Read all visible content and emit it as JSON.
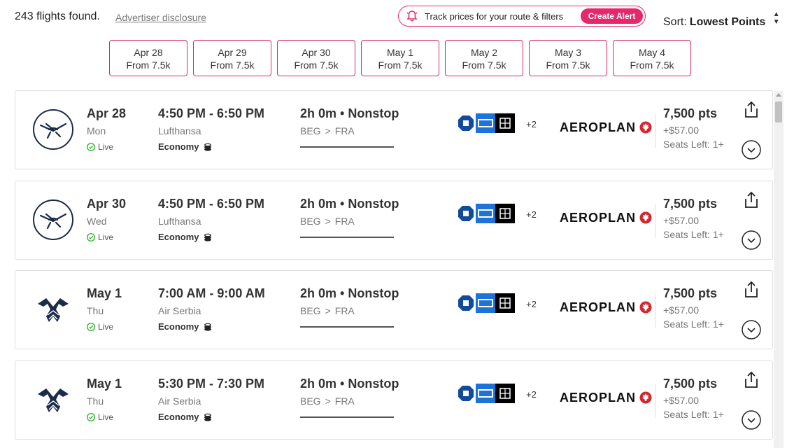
{
  "header": {
    "results_count": "243 flights found.",
    "disclosure": "Advertiser disclosure",
    "track_text": "Track prices for your route & filters",
    "create_alert": "Create Alert",
    "sort_label": "Sort:",
    "sort_value": "Lowest Points"
  },
  "date_tabs": [
    {
      "date": "Apr 28",
      "price": "From 7.5k"
    },
    {
      "date": "Apr 29",
      "price": "From 7.5k"
    },
    {
      "date": "Apr 30",
      "price": "From 7.5k"
    },
    {
      "date": "May 1",
      "price": "From 7.5k"
    },
    {
      "date": "May 2",
      "price": "From 7.5k"
    },
    {
      "date": "May 3",
      "price": "From 7.5k"
    },
    {
      "date": "May 4",
      "price": "From 7.5k"
    }
  ],
  "flights": [
    {
      "airline_icon": "lufthansa-logo-icon",
      "date": "Apr 28",
      "dow": "Mon",
      "live": "Live",
      "time": "4:50 PM - 6:50 PM",
      "airline": "Lufthansa",
      "cabin": "Economy",
      "duration": "2h 0m • Nonstop",
      "from": "BEG",
      "to": "FRA",
      "more_cards": "+2",
      "program": "AEROPLAN",
      "points": "7,500 pts",
      "taxes": "+$57.00",
      "seats": "Seats Left: 1+"
    },
    {
      "airline_icon": "lufthansa-logo-icon",
      "date": "Apr 30",
      "dow": "Wed",
      "live": "Live",
      "time": "4:50 PM - 6:50 PM",
      "airline": "Lufthansa",
      "cabin": "Economy",
      "duration": "2h 0m • Nonstop",
      "from": "BEG",
      "to": "FRA",
      "more_cards": "+2",
      "program": "AEROPLAN",
      "points": "7,500 pts",
      "taxes": "+$57.00",
      "seats": "Seats Left: 1+"
    },
    {
      "airline_icon": "air-serbia-logo-icon",
      "date": "May 1",
      "dow": "Thu",
      "live": "Live",
      "time": "7:00 AM - 9:00 AM",
      "airline": "Air Serbia",
      "cabin": "Economy",
      "duration": "2h 0m • Nonstop",
      "from": "BEG",
      "to": "FRA",
      "more_cards": "+2",
      "program": "AEROPLAN",
      "points": "7,500 pts",
      "taxes": "+$57.00",
      "seats": "Seats Left: 1+"
    },
    {
      "airline_icon": "air-serbia-logo-icon",
      "date": "May 1",
      "dow": "Thu",
      "live": "Live",
      "time": "5:30 PM - 7:30 PM",
      "airline": "Air Serbia",
      "cabin": "Economy",
      "duration": "2h 0m • Nonstop",
      "from": "BEG",
      "to": "FRA",
      "more_cards": "+2",
      "program": "AEROPLAN",
      "points": "7,500 pts",
      "taxes": "+$57.00",
      "seats": "Seats Left: 1+"
    }
  ],
  "colors": {
    "accent": "#e4286b",
    "live_green": "#2eb82e",
    "amex_blue": "#1f73d6",
    "chase_blue": "#124a9c",
    "aeroplan_red": "#d22630"
  },
  "icons": [
    "bell-alert-icon",
    "sort-arrows-icon",
    "live-check-icon",
    "coins-icon",
    "chase-card-icon",
    "amex-card-icon",
    "capital-card-icon",
    "maple-leaf-icon",
    "share-icon",
    "chevron-down-icon"
  ]
}
